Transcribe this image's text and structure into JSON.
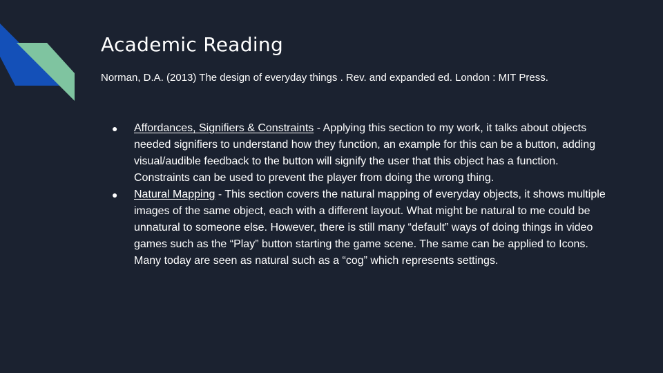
{
  "slide": {
    "title": "Academic Reading",
    "citation": "Norman, D.A. (2013) The design of everyday things . Rev. and expanded ed. London : MIT Press.",
    "bullet_glyph": "●",
    "bullets": [
      {
        "term": "Affordances, Signifiers  & Constraints",
        "text": " - Applying this section to my work, it talks about objects needed signifiers to understand  how they function, an example for this can be a button, adding visual/audible  feedback to the button will signify the user that this object has a function.  Constraints  can be used to prevent the player from doing the wrong thing."
      },
      {
        "term": "Natural  Mapping",
        "text": " - This section covers the natural  mapping of everyday objects, it shows multiple images of the same object, each with a different layout. What might be natural  to me could be unnatural  to someone else. However, there is still many “default” ways of doing things in video games such as the “Play” button starting the game scene. The same can be applied to Icons. Many today are seen as natural  such as a “cog” which represents settings."
      }
    ]
  },
  "colors": {
    "background": "#1b2230",
    "accent_blue": "#1450b8",
    "accent_green": "#7fc4a0",
    "text": "#ffffff"
  }
}
